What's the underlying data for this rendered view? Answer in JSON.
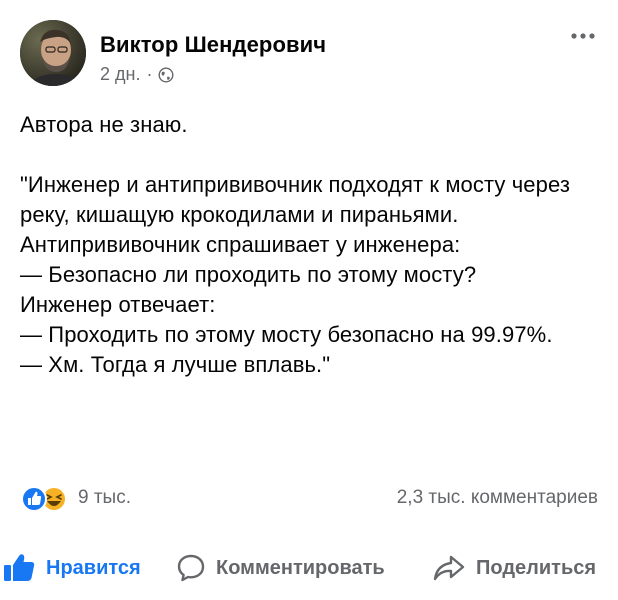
{
  "post": {
    "author": "Виктор Шендерович",
    "time": "2 дн.",
    "separator": "·",
    "privacy_icon": "globe-icon",
    "more_icon": "more-options-icon",
    "text": "Автора не знаю.\n\n\"Инженер и антипрививочник подходят к мосту через реку, кишащую крокодилами и пираньями.\nАнтипрививочник спрашивает у инженера:\n— Безопасно ли проходить по этому мосту?\nИнженер отвечает:\n— Проходить по этому мосту безопасно на 99.97%.\n— Хм. Тогда я лучше вплавь.\""
  },
  "reactions": {
    "icons": [
      "like-reaction-icon",
      "haha-reaction-icon"
    ],
    "count": "9 тыс.",
    "comments": "2,3 тыс. комментариев"
  },
  "actions": {
    "like_label": "Нравится",
    "comment_label": "Комментировать",
    "share_label": "Поделиться"
  },
  "colors": {
    "accent": "#1877f2",
    "secondary_text": "#65676b",
    "primary_text": "#050505",
    "haha_yellow": "#f7b125"
  }
}
